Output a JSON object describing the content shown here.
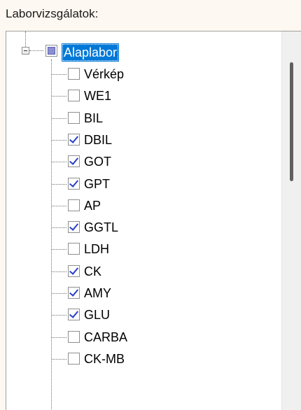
{
  "group": {
    "label": "Laborvizsgálatok:"
  },
  "tree": {
    "root": {
      "label": "Alaplabor",
      "state": "indeterminate",
      "expanded": true,
      "selected": true
    },
    "items": [
      {
        "label": "Vérkép",
        "checked": false
      },
      {
        "label": "WE1",
        "checked": false
      },
      {
        "label": "BIL",
        "checked": false
      },
      {
        "label": "DBIL",
        "checked": true
      },
      {
        "label": "GOT",
        "checked": true
      },
      {
        "label": "GPT",
        "checked": true
      },
      {
        "label": "AP",
        "checked": false
      },
      {
        "label": "GGTL",
        "checked": true
      },
      {
        "label": "LDH",
        "checked": false
      },
      {
        "label": "CK",
        "checked": true
      },
      {
        "label": "AMY",
        "checked": true
      },
      {
        "label": "GLU",
        "checked": true
      },
      {
        "label": "CARBA",
        "checked": false
      },
      {
        "label": "CK-MB",
        "checked": false
      }
    ]
  },
  "colors": {
    "selection": "#0078d7",
    "check": "#2a3fc8",
    "indeterminate": "#8b8fd0"
  },
  "icons": {
    "expander": "minus-box-icon",
    "check": "checkmark-icon"
  }
}
